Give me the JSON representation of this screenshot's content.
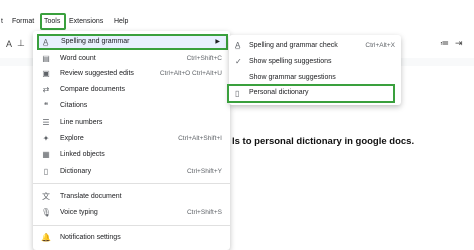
{
  "menubar": {
    "partial": "t",
    "format": "Format",
    "tools": "Tools",
    "extensions": "Extensions",
    "help": "Help"
  },
  "tools_menu": {
    "spelling": "Spelling and grammar",
    "word_count": {
      "label": "Word count",
      "shortcut": "Ctrl+Shift+C"
    },
    "review": {
      "label": "Review suggested edits",
      "shortcut": "Ctrl+Alt+O Ctrl+Alt+U"
    },
    "compare": "Compare documents",
    "citations": "Citations",
    "line_numbers": "Line numbers",
    "explore": {
      "label": "Explore",
      "shortcut": "Ctrl+Alt+Shift+I"
    },
    "linked": "Linked objects",
    "dictionary": {
      "label": "Dictionary",
      "shortcut": "Ctrl+Shift+Y"
    },
    "translate": "Translate document",
    "voice": {
      "label": "Voice typing",
      "shortcut": "Ctrl+Shift+S"
    },
    "notification": "Notification settings"
  },
  "spelling_submenu": {
    "check": {
      "label": "Spelling and grammar check",
      "shortcut": "Ctrl+Alt+X"
    },
    "show_spelling": "Show spelling suggestions",
    "show_grammar": "Show grammar suggestions",
    "personal": "Personal dictionary"
  },
  "document": {
    "text": "ls to personal dictionary in google docs."
  },
  "colors": {
    "highlight": "#3aa03d",
    "selected_bg": "#e8f0fe"
  }
}
